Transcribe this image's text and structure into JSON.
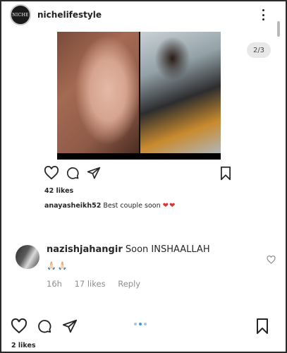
{
  "post": {
    "avatar_text": "NICHE",
    "username": "nichelifestyle",
    "carousel_position": "2/3",
    "likes": "42 likes",
    "caption": {
      "username": "anayasheikh52",
      "text": "Best couple soon",
      "hearts": "❤❤"
    }
  },
  "comment": {
    "username": "nazishjahangir",
    "text": "Soon INSHAALLAH",
    "emoji": "🙏🏻🙏🏻",
    "time": "16h",
    "likes": "17 likes",
    "reply_label": "Reply"
  },
  "bottom": {
    "likes": "2 likes",
    "page_dots": 3,
    "active_dot": 1
  },
  "icons": {
    "more": "more-vertical-icon",
    "like": "heart-icon",
    "comment": "comment-icon",
    "share": "send-icon",
    "save": "bookmark-icon",
    "comment_like": "heart-small-icon"
  },
  "colors": {
    "heart_red": "#d8343b",
    "dot_active": "#3897f0",
    "meta_gray": "#8e8e8e"
  }
}
